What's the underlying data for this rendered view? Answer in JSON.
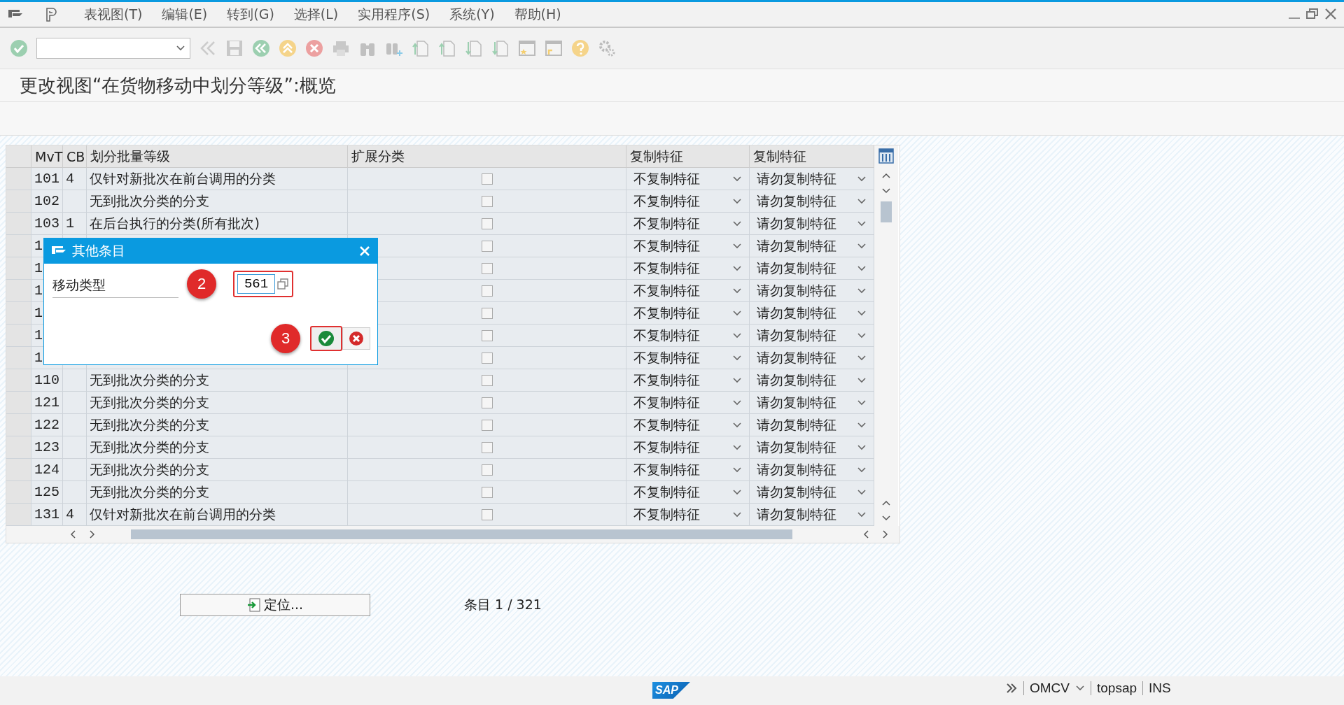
{
  "menu": [
    "表视图(T)",
    "编辑(E)",
    "转到(G)",
    "选择(L)",
    "实用程序(S)",
    "系统(Y)",
    "帮助(H)"
  ],
  "page_title": "更改视图“在货物移动中划分等级”:概览",
  "table": {
    "columns": [
      "MvT",
      "CB",
      "划分批量等级",
      "扩展分类",
      "复制特征",
      "复制特征"
    ],
    "rows": [
      {
        "mvt": "101",
        "cb": "4",
        "description": "仅针对新批次在前台调用的分类",
        "checked": false,
        "copy_a": "不复制特征",
        "copy_b": "请勿复制特征"
      },
      {
        "mvt": "102",
        "description": "无到批次分类的分支",
        "checked": false,
        "copy_a": "不复制特征",
        "copy_b": "请勿复制特征"
      },
      {
        "mvt": "103",
        "cb": "1",
        "description": "在后台执行的分类(所有批次)",
        "checked": false,
        "copy_a": "不复制特征",
        "copy_b": "请勿复制特征"
      },
      {
        "mvt": "1",
        "checked": false,
        "copy_a": "不复制特征",
        "copy_b": "请勿复制特征"
      },
      {
        "mvt": "1",
        "checked": false,
        "copy_a": "不复制特征",
        "copy_b": "请勿复制特征"
      },
      {
        "mvt": "1",
        "checked": false,
        "copy_a": "不复制特征",
        "copy_b": "请勿复制特征"
      },
      {
        "mvt": "1",
        "checked": false,
        "copy_a": "不复制特征",
        "copy_b": "请勿复制特征"
      },
      {
        "mvt": "1",
        "checked": false,
        "copy_a": "不复制特征",
        "copy_b": "请勿复制特征"
      },
      {
        "mvt": "1",
        "checked": false,
        "copy_a": "不复制特征",
        "copy_b": "请勿复制特征"
      },
      {
        "mvt": "110",
        "description": "无到批次分类的分支",
        "checked": false,
        "copy_a": "不复制特征",
        "copy_b": "请勿复制特征"
      },
      {
        "mvt": "121",
        "description": "无到批次分类的分支",
        "checked": false,
        "copy_a": "不复制特征",
        "copy_b": "请勿复制特征"
      },
      {
        "mvt": "122",
        "description": "无到批次分类的分支",
        "checked": false,
        "copy_a": "不复制特征",
        "copy_b": "请勿复制特征"
      },
      {
        "mvt": "123",
        "description": "无到批次分类的分支",
        "checked": false,
        "copy_a": "不复制特征",
        "copy_b": "请勿复制特征"
      },
      {
        "mvt": "124",
        "description": "无到批次分类的分支",
        "checked": false,
        "copy_a": "不复制特征",
        "copy_b": "请勿复制特征"
      },
      {
        "mvt": "125",
        "description": "无到批次分类的分支",
        "checked": false,
        "copy_a": "不复制特征",
        "copy_b": "请勿复制特征"
      },
      {
        "mvt": "131",
        "cb": "4",
        "description": "仅针对新批次在前台调用的分类",
        "checked": false,
        "copy_a": "不复制特征",
        "copy_b": "请勿复制特征"
      }
    ]
  },
  "dialog": {
    "title": "其他条目",
    "field_label": "移动类型",
    "field_value": "561",
    "step_field": "2",
    "step_confirm": "3"
  },
  "locate_button": "定位...",
  "entry_counter": "条目 1 / 321",
  "status_bar": {
    "logo": "SAP",
    "items": [
      "OMCV",
      "topsap",
      "INS"
    ]
  }
}
